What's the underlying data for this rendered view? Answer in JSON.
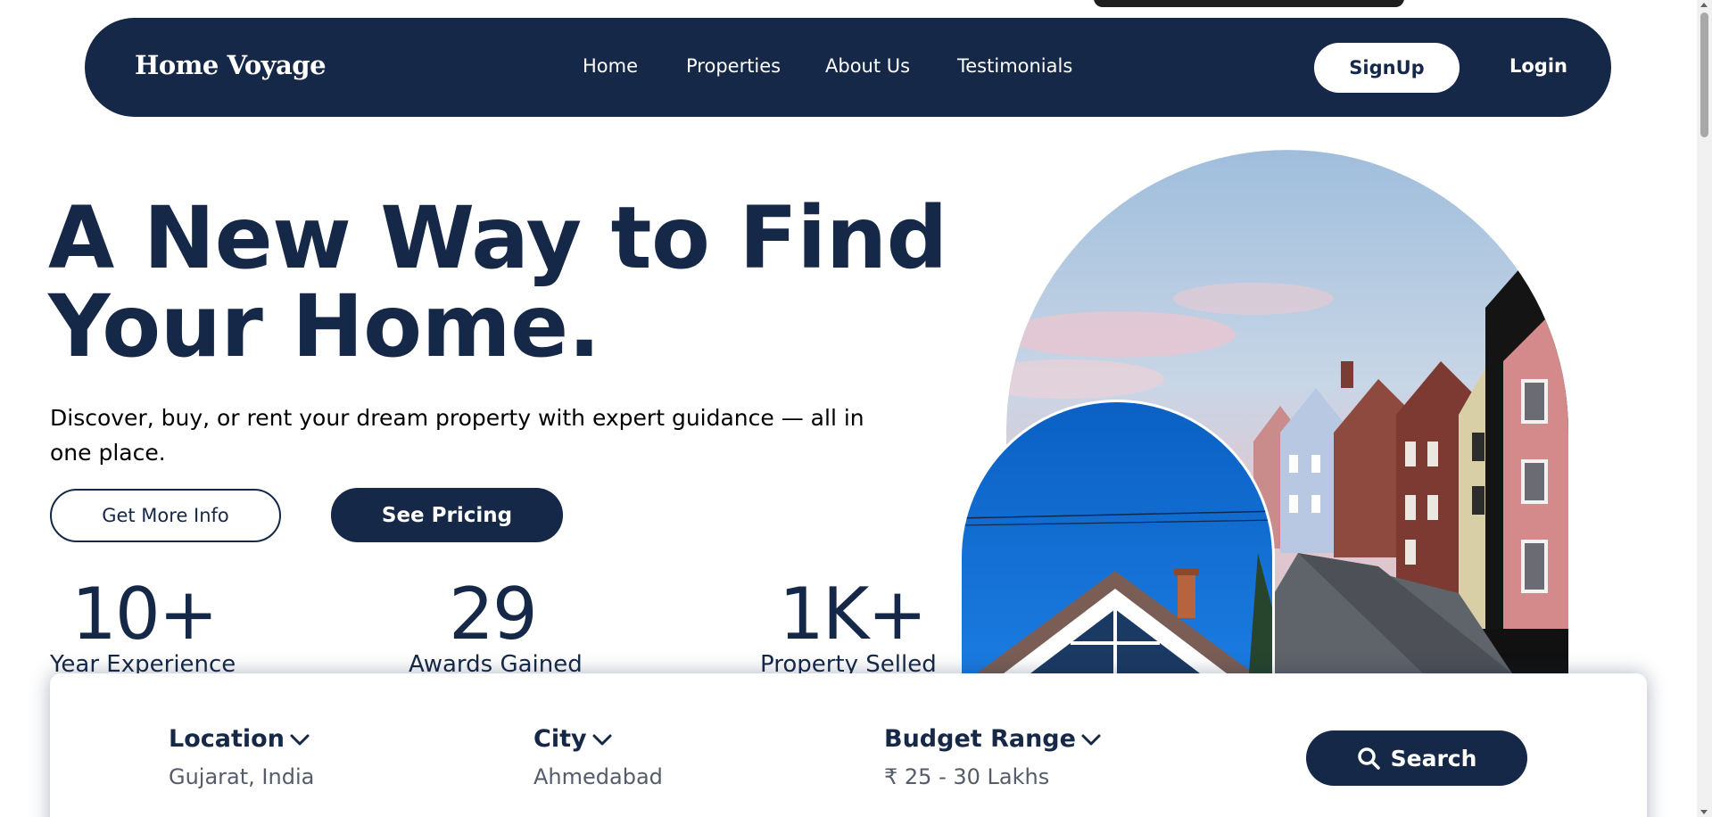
{
  "nav": {
    "brand": "Home Voyage",
    "links": [
      "Home",
      "Properties",
      "About Us",
      "Testimonials"
    ],
    "signup_label": "SignUp",
    "login_label": "Login"
  },
  "hero": {
    "title_line1": "A New Way to Find",
    "title_line2": "Your Home.",
    "subtitle": "Discover, buy, or rent your dream property with expert guidance — all in one place.",
    "more_info_label": "Get More Info",
    "pricing_label": "See Pricing"
  },
  "stats": [
    {
      "value": "10+",
      "label": "Year Experience"
    },
    {
      "value": "29",
      "label": "Awards Gained"
    },
    {
      "value": "1K+",
      "label": "Property Selled"
    }
  ],
  "search": {
    "location_label": "Location",
    "location_value": "Gujarat, India",
    "city_label": "City",
    "city_value": "Ahmedabad",
    "budget_label": "Budget Range",
    "budget_value": "₹ 25 - 30 Lakhs",
    "button_label": "Search"
  },
  "icons": {
    "chevron": "chevron-down-icon",
    "search": "search-icon"
  },
  "colors": {
    "primary": "#162848",
    "background": "#ffffff",
    "muted_text": "#545c6a"
  }
}
